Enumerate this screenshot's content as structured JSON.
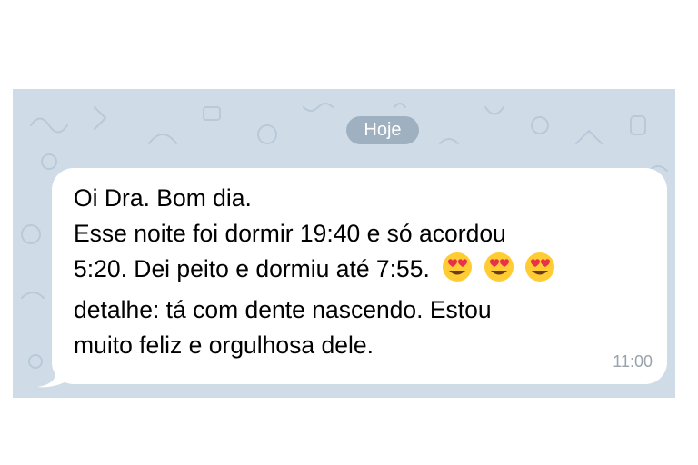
{
  "chat": {
    "date_label": "Hoje",
    "background_color": "#cfdce8",
    "message": {
      "lines": [
        "Oi Dra. Bom dia.",
        "Esse noite foi dormir 19:40 e só acordou",
        "5:20. Dei peito e dormiu até 7:55.",
        "detalhe: tá com dente nascendo. Estou",
        "muito feliz e orgulhosa dele."
      ],
      "emojis": [
        "heart-eyes-emoji",
        "heart-eyes-emoji",
        "heart-eyes-emoji"
      ],
      "time": "11:00"
    }
  }
}
